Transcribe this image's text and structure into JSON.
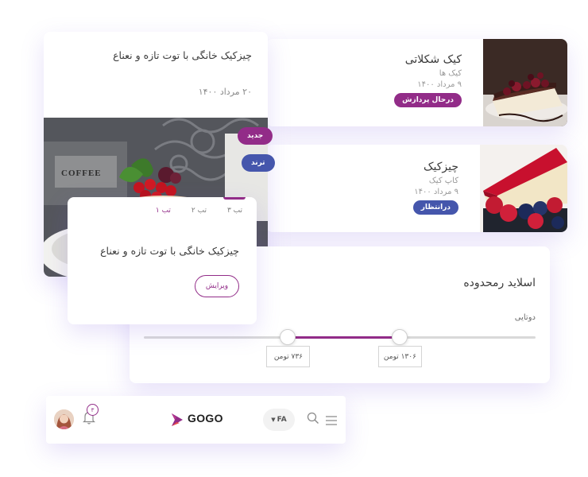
{
  "colors": {
    "primary": "#922c88",
    "secondary": "#4556ac"
  },
  "list_items": [
    {
      "title": "کیک شکلاتی",
      "category": "کیک ها",
      "date": "۹ مرداد ۱۴۰۰",
      "status": "درحال پردازش",
      "status_color": "#922c88"
    },
    {
      "title": "چیزکیک",
      "category": "کاپ کیک",
      "date": "۹ مرداد ۱۴۰۰",
      "status": "درانتظار",
      "status_color": "#4556ac"
    }
  ],
  "feature_card": {
    "title": "چیزکیک خانگی با توت تازه و نعناع",
    "date": "۲۰ مرداد ۱۴۰۰",
    "badges": {
      "new": "جدید",
      "trend": "ترند"
    },
    "image_text": "COFFEE"
  },
  "tab_card": {
    "tabs": [
      "تب ۱",
      "تب ۲",
      "تب ۳"
    ],
    "active_tab": 0,
    "body": "چیزکیک خانگی با توت تازه و نعناع",
    "edit_label": "ویرایش"
  },
  "slider_card": {
    "title": "اسلاید رمحدوده",
    "label": "دوتایی",
    "range": {
      "min": 0,
      "max": 2000,
      "low": 736,
      "high": 1306
    },
    "low_text": "۷۳۶ تومن",
    "high_text": "۱۳۰۶ تومن"
  },
  "navbar": {
    "logo": "GOGO",
    "lang": "FA",
    "notification_count": "۳",
    "icons": [
      "menu-icon",
      "search-icon",
      "bell-icon"
    ]
  }
}
